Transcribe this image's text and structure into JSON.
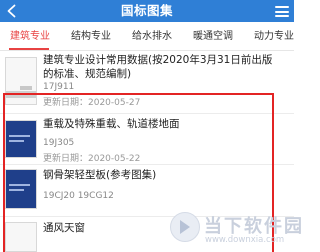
{
  "header": {
    "title": "国标图集"
  },
  "tabs": [
    {
      "label": "建筑专业",
      "active": true
    },
    {
      "label": "结构专业",
      "active": false
    },
    {
      "label": "给水排水",
      "active": false
    },
    {
      "label": "暖通空调",
      "active": false
    },
    {
      "label": "动力专业",
      "active": false
    }
  ],
  "items": [
    {
      "title": "建筑专业设计常用数据(按2020年3月31日前出版的标准、规范编制)",
      "code": "17J911",
      "date": "更新日期：2020-05-27",
      "thumb": "white"
    },
    {
      "title": "重载及特殊重载、轨道楼地面",
      "code": "19J305",
      "date": "更新日期：2020-05-22",
      "thumb": "dark"
    },
    {
      "title": "钢骨架轻型板(参考图集)",
      "code": "19CJ20 19CG12",
      "date": "",
      "thumb": "dark"
    },
    {
      "title": "通风天窗",
      "code": "",
      "date": "",
      "thumb": "white"
    }
  ],
  "watermark": {
    "name": "当下软件园",
    "url": "www.downxia.com"
  },
  "colors": {
    "header": "#2f7fd6",
    "tab_active": "#e84242",
    "highlight": "#e32424"
  }
}
